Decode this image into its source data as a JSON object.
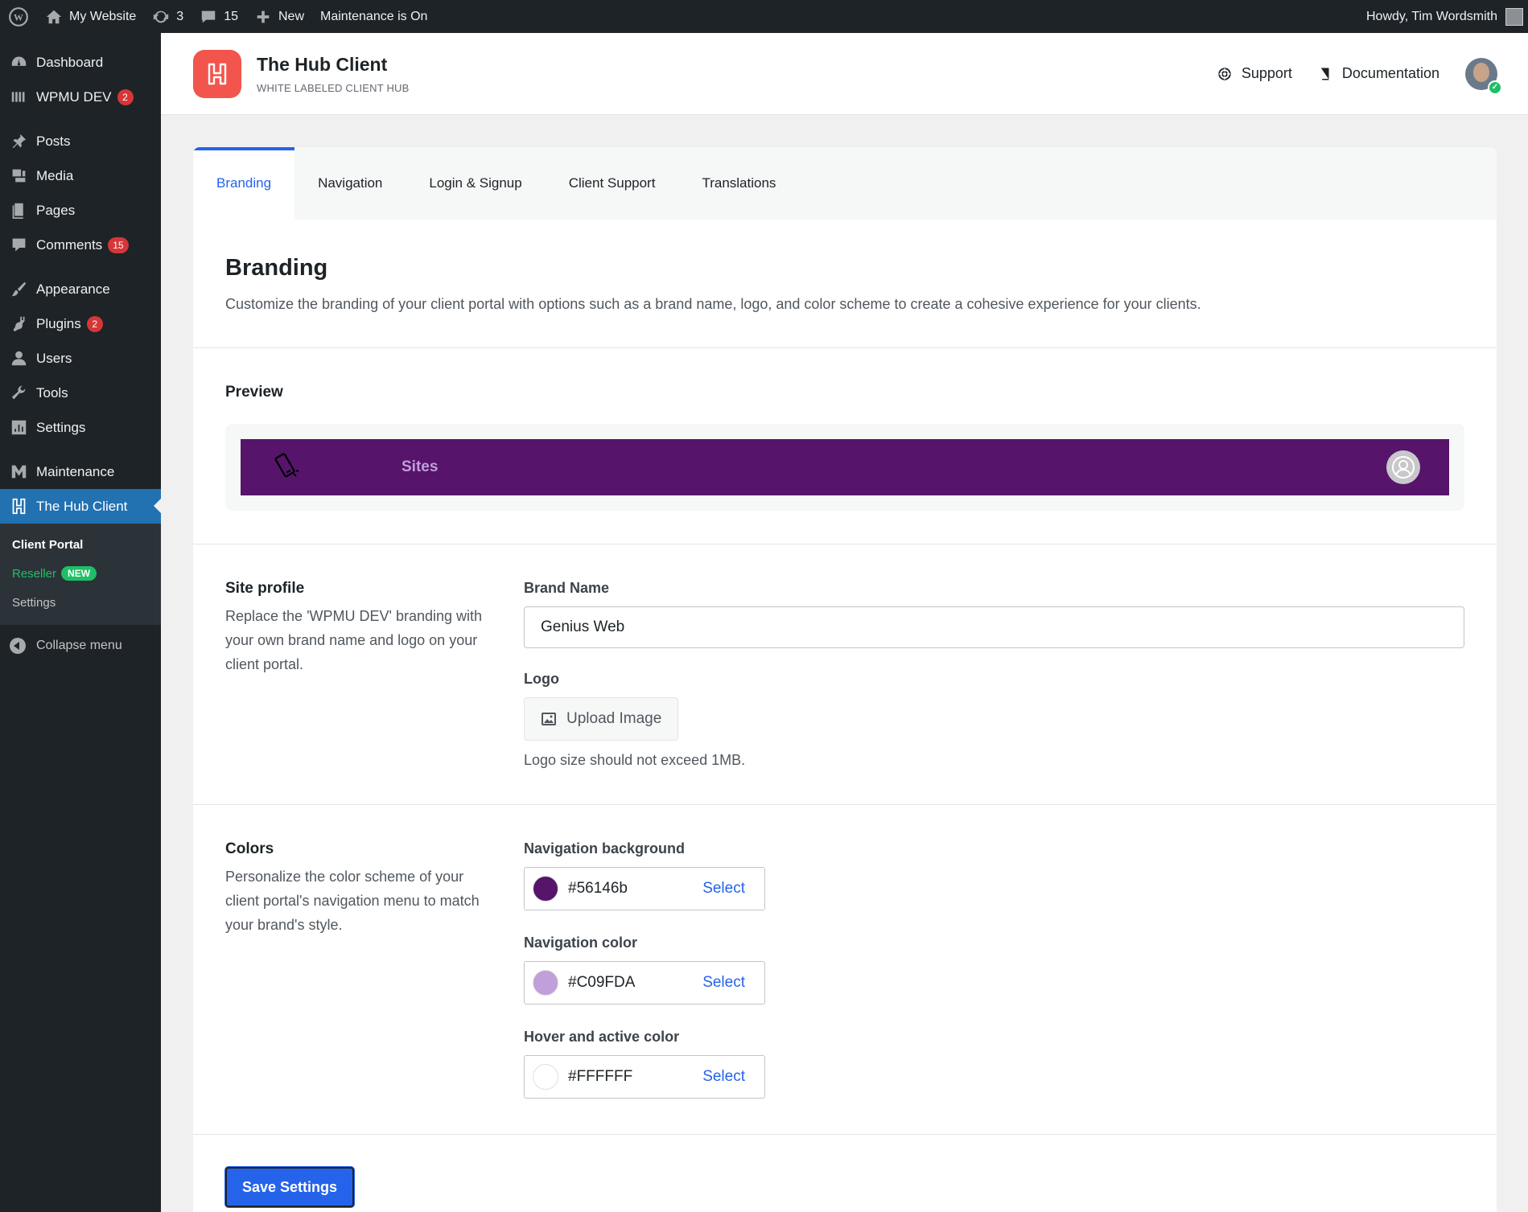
{
  "adminbar": {
    "site_name": "My Website",
    "updates_count": "3",
    "comments_count": "15",
    "new_label": "New",
    "maintenance_label": "Maintenance is On",
    "howdy": "Howdy, Tim Wordsmith"
  },
  "sidebar": {
    "items": [
      {
        "label": "Dashboard",
        "icon": "dashboard-icon"
      },
      {
        "label": "WPMU DEV",
        "icon": "wpmudev-icon",
        "badge": "2"
      },
      {
        "label": "Posts",
        "icon": "pin-icon"
      },
      {
        "label": "Media",
        "icon": "media-icon"
      },
      {
        "label": "Pages",
        "icon": "pages-icon"
      },
      {
        "label": "Comments",
        "icon": "comment-icon",
        "badge": "15"
      },
      {
        "label": "Appearance",
        "icon": "brush-icon"
      },
      {
        "label": "Plugins",
        "icon": "plugin-icon",
        "badge": "2"
      },
      {
        "label": "Users",
        "icon": "user-icon"
      },
      {
        "label": "Tools",
        "icon": "wrench-icon"
      },
      {
        "label": "Settings",
        "icon": "settings-icon"
      },
      {
        "label": "Maintenance",
        "icon": "maintenance-icon"
      },
      {
        "label": "The Hub Client",
        "icon": "hub-client-icon"
      }
    ],
    "submenu": {
      "client_portal": "Client Portal",
      "reseller": "Reseller",
      "reseller_badge": "NEW",
      "settings": "Settings"
    },
    "collapse": "Collapse menu"
  },
  "header": {
    "title": "The Hub Client",
    "subtitle": "WHITE LABELED CLIENT HUB",
    "support": "Support",
    "documentation": "Documentation"
  },
  "tabs": [
    "Branding",
    "Navigation",
    "Login & Signup",
    "Client Support",
    "Translations"
  ],
  "branding": {
    "title": "Branding",
    "description": "Customize the branding of your client portal with options such as a brand name, logo, and color scheme to create a cohesive experience for your clients."
  },
  "preview": {
    "label": "Preview",
    "nav_item": "Sites"
  },
  "site_profile": {
    "label": "Site profile",
    "help": "Replace the 'WPMU DEV' branding with your own brand name and logo on your client portal.",
    "brand_name_label": "Brand Name",
    "brand_name_value": "Genius Web",
    "logo_label": "Logo",
    "upload_label": "Upload Image",
    "logo_note": "Logo size should not exceed 1MB."
  },
  "colors": {
    "label": "Colors",
    "help": "Personalize the color scheme of your client portal's navigation menu to match your brand's style.",
    "fields": [
      {
        "label": "Navigation background",
        "value": "#56146b",
        "swatch": "#56146b",
        "select": "Select"
      },
      {
        "label": "Navigation color",
        "value": "#C09FDA",
        "swatch": "#C09FDA",
        "select": "Select"
      },
      {
        "label": "Hover and active color",
        "value": "#FFFFFF",
        "swatch": "#FFFFFF",
        "select": "Select"
      }
    ]
  },
  "save_label": "Save Settings"
}
